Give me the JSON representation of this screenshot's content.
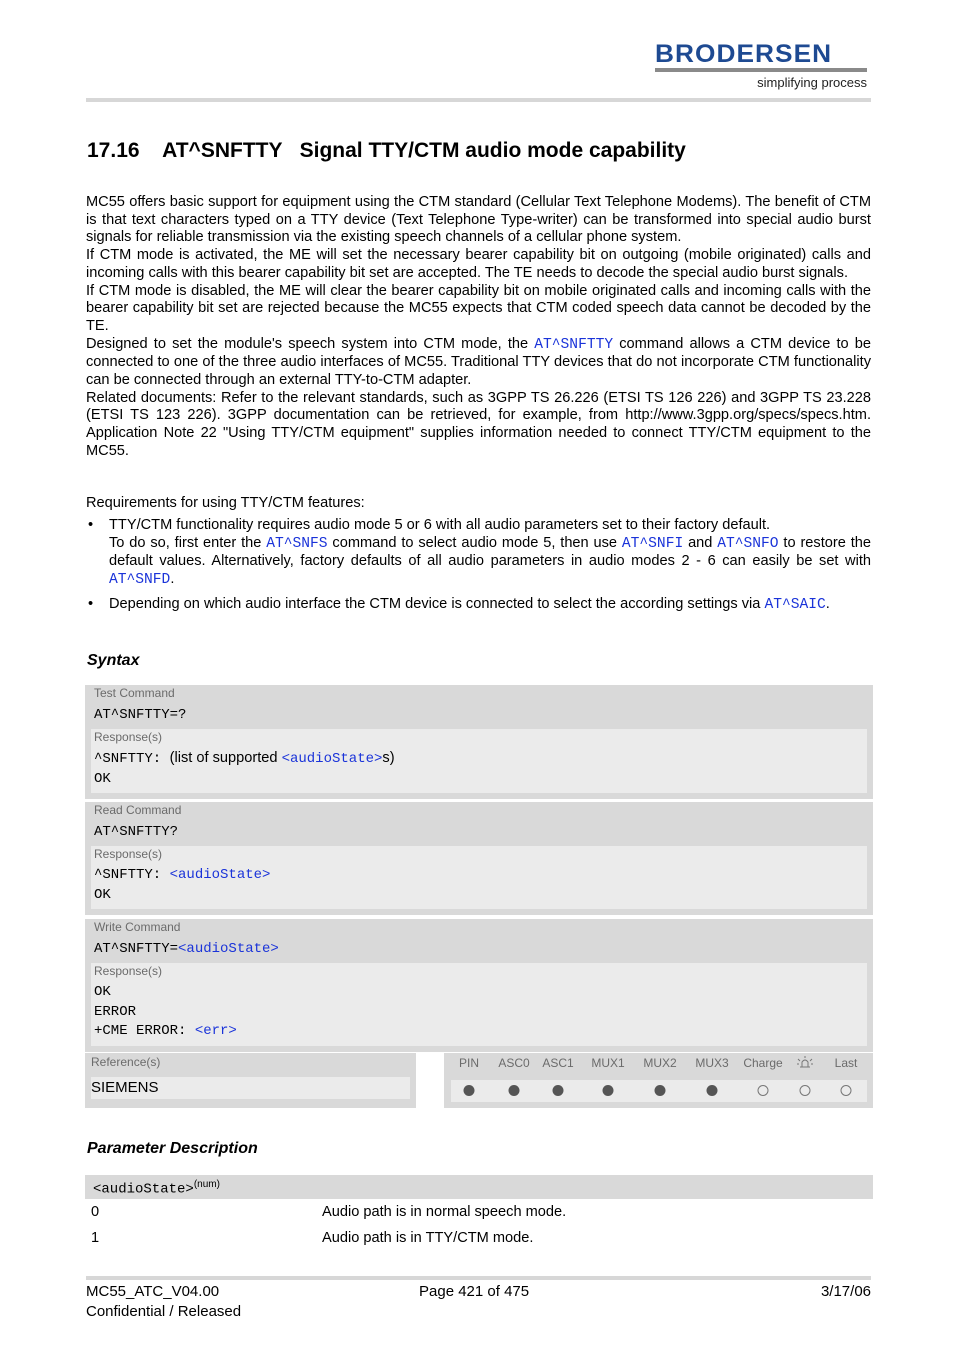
{
  "header": {
    "logo_word": "BRODERSEN",
    "logo_tagline": "simplifying process"
  },
  "section": {
    "number": "17.16",
    "command": "AT^SNFTTY",
    "title": "Signal TTY/CTM audio mode capability"
  },
  "intro": {
    "p1": "MC55 offers basic support for equipment using the CTM standard (Cellular Text Telephone Modems). The benefit of CTM is that text characters typed on a TTY device (Text Telephone Type-writer) can be transformed into special audio burst signals for reliable transmission via the existing speech channels of a cellular phone system.",
    "p2": "If CTM mode is activated, the ME will set the necessary bearer capability bit on outgoing (mobile originated) calls and incoming calls with this bearer capability bit set are accepted. The TE needs to decode the special audio burst signals.",
    "p3": "If CTM mode is disabled, the ME will clear the bearer capability bit on mobile originated calls and incoming calls with the bearer capability bit set are rejected because the MC55 expects that CTM coded speech data cannot be decoded by the TE.",
    "p4_before": "Designed to set the module's speech system into CTM mode, the ",
    "p4_link": "AT^SNFTTY",
    "p4_after": " command allows a CTM device to be connected to one of the three audio interfaces of MC55. Traditional TTY devices that do not incorporate CTM functionality can be connected through an external TTY-to-CTM adapter.",
    "p5": "Related documents: Refer to the relevant standards, such as 3GPP TS 26.226 (ETSI TS 126 226) and 3GPP TS 23.228 (ETSI TS 123 226). 3GPP documentation can be retrieved, for example, from http://www.3gpp.org/specs/specs.htm. Application Note 22 \"Using TTY/CTM equipment\" supplies information needed to connect TTY/CTM equipment to the MC55."
  },
  "requirements": {
    "title": "Requirements for using TTY/CTM features:",
    "bullet_char": "•",
    "b1_line1": "TTY/CTM functionality requires audio mode 5 or 6 with all audio parameters set to their factory default.",
    "b1_t1": "To do so, first enter the ",
    "b1_l1": "AT^SNFS",
    "b1_t2": " command to select audio mode 5, then use ",
    "b1_l2": "AT^SNFI",
    "b1_t3": " and ",
    "b1_l3": "AT^SNFO",
    "b1_t4": " to restore the default values. Alternatively, factory defaults of all audio parameters in audio modes 2 - 6 can easily be set with ",
    "b1_l4": "AT^SNFD",
    "b1_t5": ".",
    "b2_text": "Depending on which audio interface the CTM device is connected to select the according settings via ",
    "b2_link": "AT^SAIC",
    "b2_end": "."
  },
  "syntax": {
    "heading": "Syntax",
    "response_label": "Response(s)",
    "test": {
      "label": "Test Command",
      "command": "AT^SNFTTY=?",
      "resp_prefix": "^SNFTTY: ",
      "resp_text1": " (list of supported ",
      "resp_link": "<audioState>",
      "resp_text2": "s)",
      "ok": "OK"
    },
    "read": {
      "label": "Read Command",
      "command": "AT^SNFTTY?",
      "resp_prefix": "^SNFTTY: ",
      "resp_link": "<audioState>",
      "ok": "OK"
    },
    "write": {
      "label": "Write Command",
      "command_prefix": "AT^SNFTTY=",
      "command_link": "<audioState>",
      "resp_ok": "OK",
      "resp_error": "ERROR",
      "resp_cme_prefix": "+CME ERROR: ",
      "resp_cme_link": "<err>"
    },
    "reference": {
      "label": "Reference(s)",
      "value": "SIEMENS",
      "columns": [
        {
          "label": "PIN",
          "supported": true
        },
        {
          "label": "ASC0",
          "supported": true
        },
        {
          "label": "ASC1",
          "supported": true
        },
        {
          "label": "MUX1",
          "supported": true
        },
        {
          "label": "MUX2",
          "supported": true
        },
        {
          "label": "MUX3",
          "supported": true
        },
        {
          "label": "Charge",
          "supported": false
        },
        {
          "label": "",
          "icon": "alarm-bell-icon",
          "supported": false
        },
        {
          "label": "Last",
          "supported": false
        }
      ]
    }
  },
  "parameters": {
    "heading": "Parameter Description",
    "name": "<audioState>",
    "type_sup": "(num)",
    "values": [
      {
        "value": "0",
        "desc": "Audio path is in normal speech mode."
      },
      {
        "value": "1",
        "desc": "Audio path is in TTY/CTM mode."
      }
    ]
  },
  "footer": {
    "doc_id": "MC55_ATC_V04.00",
    "status": "Confidential / Released",
    "page": "Page 421 of 475",
    "date": "3/17/06"
  }
}
